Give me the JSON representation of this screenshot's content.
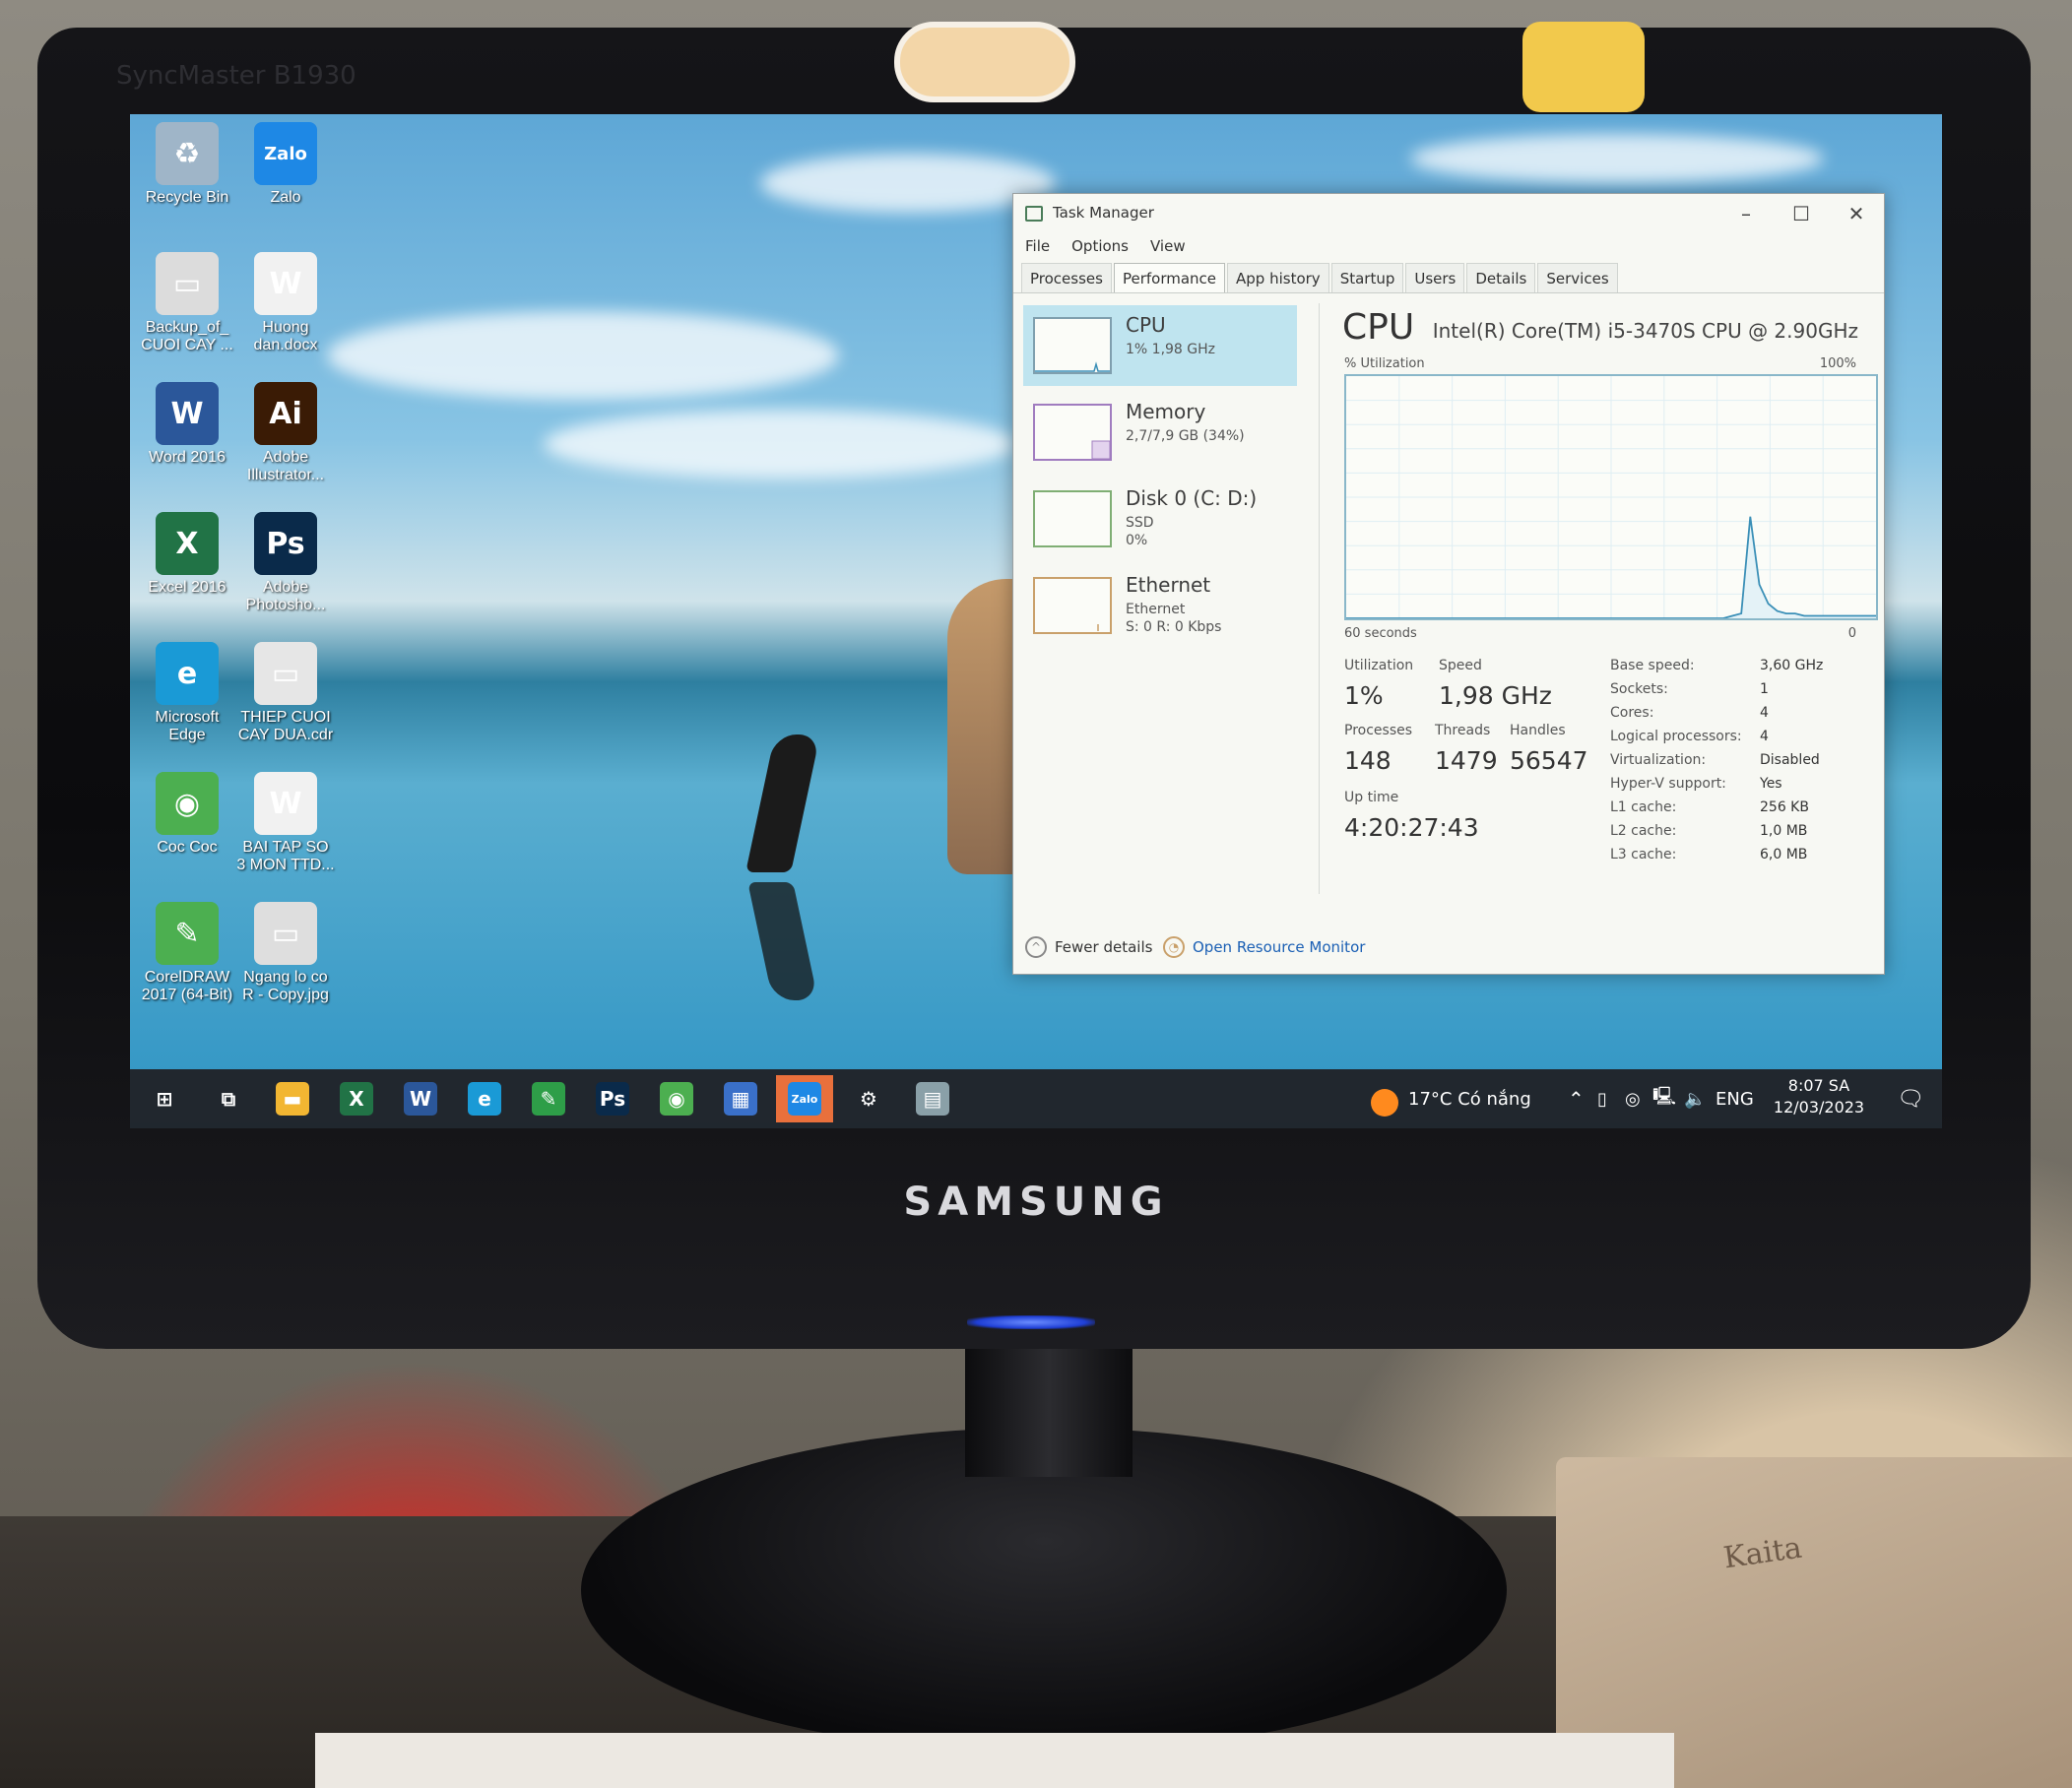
{
  "monitor": {
    "model": "SyncMaster B1930",
    "brand": "SAMSUNG"
  },
  "desktop": {
    "icons": [
      {
        "label": "Recycle Bin",
        "glyph": "♻",
        "color": "#9fb5c8",
        "icon": "recycle-bin-icon"
      },
      {
        "label": "Zalo",
        "glyph": "Zalo",
        "color": "#1e88e5",
        "icon": "zalo-icon"
      },
      {
        "label": "Backup_of_ CUOI CAY ...",
        "glyph": "▭",
        "color": "#dcdcdc",
        "icon": "file-icon"
      },
      {
        "label": "Huong dan.docx",
        "glyph": "W",
        "color": "#f1f1f1",
        "icon": "word-doc-icon"
      },
      {
        "label": "Word 2016",
        "glyph": "W",
        "color": "#2b579a",
        "icon": "word-icon"
      },
      {
        "label": "Adobe Illustrator...",
        "glyph": "Ai",
        "color": "#3a1b05",
        "icon": "illustrator-icon"
      },
      {
        "label": "Excel 2016",
        "glyph": "X",
        "color": "#217346",
        "icon": "excel-icon"
      },
      {
        "label": "Adobe Photosho...",
        "glyph": "Ps",
        "color": "#0a2a4a",
        "icon": "photoshop-icon"
      },
      {
        "label": "Microsoft Edge",
        "glyph": "e",
        "color": "#1a9ad6",
        "icon": "edge-icon"
      },
      {
        "label": "THIEP CUOI CAY DUA.cdr",
        "glyph": "▭",
        "color": "#e6e6e6",
        "icon": "cdr-file-icon"
      },
      {
        "label": "Coc Coc",
        "glyph": "◉",
        "color": "#4caf50",
        "icon": "coccoc-icon"
      },
      {
        "label": "BAI TAP SO 3 MON TTD...",
        "glyph": "W",
        "color": "#f1f1f1",
        "icon": "word-doc-icon"
      },
      {
        "label": "CorelDRAW 2017 (64-Bit)",
        "glyph": "✎",
        "color": "#4caf50",
        "icon": "coreldraw-icon"
      },
      {
        "label": "Ngang lo co R - Copy.jpg",
        "glyph": "▭",
        "color": "#dedede",
        "icon": "image-file-icon"
      }
    ]
  },
  "taskbar": {
    "weather": "17°C Có nắng",
    "lang": "ENG",
    "time": "8:07 SA",
    "date": "12/03/2023",
    "items": [
      {
        "glyph": "⊞",
        "icon": "start-icon",
        "bg": "transparent"
      },
      {
        "glyph": "⧉",
        "icon": "task-view-icon",
        "bg": "transparent"
      },
      {
        "glyph": "▬",
        "icon": "file-explorer-icon",
        "bg": "#f2b632"
      },
      {
        "glyph": "X",
        "icon": "excel-icon",
        "bg": "#217346"
      },
      {
        "glyph": "W",
        "icon": "word-icon",
        "bg": "#2b579a"
      },
      {
        "glyph": "e",
        "icon": "edge-icon",
        "bg": "#1a9ad6"
      },
      {
        "glyph": "✎",
        "icon": "coreldraw-icon",
        "bg": "#2e9e48"
      },
      {
        "glyph": "Ps",
        "icon": "photoshop-icon",
        "bg": "#0a2a4a"
      },
      {
        "glyph": "◉",
        "icon": "coccoc-icon",
        "bg": "#4caf50"
      },
      {
        "glyph": "▦",
        "icon": "calculator-icon",
        "bg": "#3a70c9"
      },
      {
        "glyph": "Zalo",
        "icon": "zalo-icon",
        "bg": "#1e88e5"
      },
      {
        "glyph": "⚙",
        "icon": "settings-icon",
        "bg": "transparent"
      },
      {
        "glyph": "▤",
        "icon": "task-manager-icon",
        "bg": "#8aa0a8"
      }
    ]
  },
  "task_manager": {
    "title": "Task Manager",
    "menu": [
      "File",
      "Options",
      "View"
    ],
    "tabs": [
      "Processes",
      "Performance",
      "App history",
      "Startup",
      "Users",
      "Details",
      "Services"
    ],
    "active_tab": "Performance",
    "sidebar": [
      {
        "name": "CPU",
        "sub": "1% 1,98 GHz"
      },
      {
        "name": "Memory",
        "sub": "2,7/7,9 GB (34%)"
      },
      {
        "name": "Disk 0 (C: D:)",
        "sub": "SSD\n0%"
      },
      {
        "name": "Ethernet",
        "sub": "Ethernet\nS: 0 R: 0 Kbps"
      }
    ],
    "cpu": {
      "title": "CPU",
      "model": "Intel(R) Core(TM) i5-3470S CPU @ 2.90GHz",
      "graph_label": "% Utilization",
      "graph_max": "100%",
      "graph_time": "60 seconds",
      "graph_min": "0",
      "labels": {
        "utilization": "Utilization",
        "speed": "Speed",
        "processes": "Processes",
        "threads": "Threads",
        "handles": "Handles",
        "uptime": "Up time"
      },
      "utilization": "1%",
      "speed": "1,98 GHz",
      "processes": "148",
      "threads": "1479",
      "handles": "56547",
      "uptime": "4:20:27:43",
      "specs": [
        {
          "k": "Base speed:",
          "v": "3,60 GHz"
        },
        {
          "k": "Sockets:",
          "v": "1"
        },
        {
          "k": "Cores:",
          "v": "4"
        },
        {
          "k": "Logical processors:",
          "v": "4"
        },
        {
          "k": "Virtualization:",
          "v": "Disabled"
        },
        {
          "k": "Hyper-V support:",
          "v": "Yes"
        },
        {
          "k": "L1 cache:",
          "v": "256 KB"
        },
        {
          "k": "L2 cache:",
          "v": "1,0 MB"
        },
        {
          "k": "L3 cache:",
          "v": "6,0 MB"
        }
      ],
      "history_pct": [
        0,
        0,
        0,
        0,
        0,
        0,
        0,
        0,
        0,
        0,
        0,
        0,
        0,
        0,
        0,
        0,
        0,
        0,
        0,
        0,
        0,
        0,
        0,
        0,
        0,
        0,
        0,
        0,
        0,
        0,
        0,
        0,
        0,
        0,
        0,
        0,
        0,
        0,
        0,
        0,
        0,
        0,
        0,
        1,
        2,
        42,
        14,
        6,
        3,
        2,
        2,
        1,
        1,
        1,
        1,
        1,
        1,
        1,
        1,
        1
      ]
    },
    "fewer_details": "Fewer details",
    "open_resource_monitor": "Open Resource Monitor"
  }
}
